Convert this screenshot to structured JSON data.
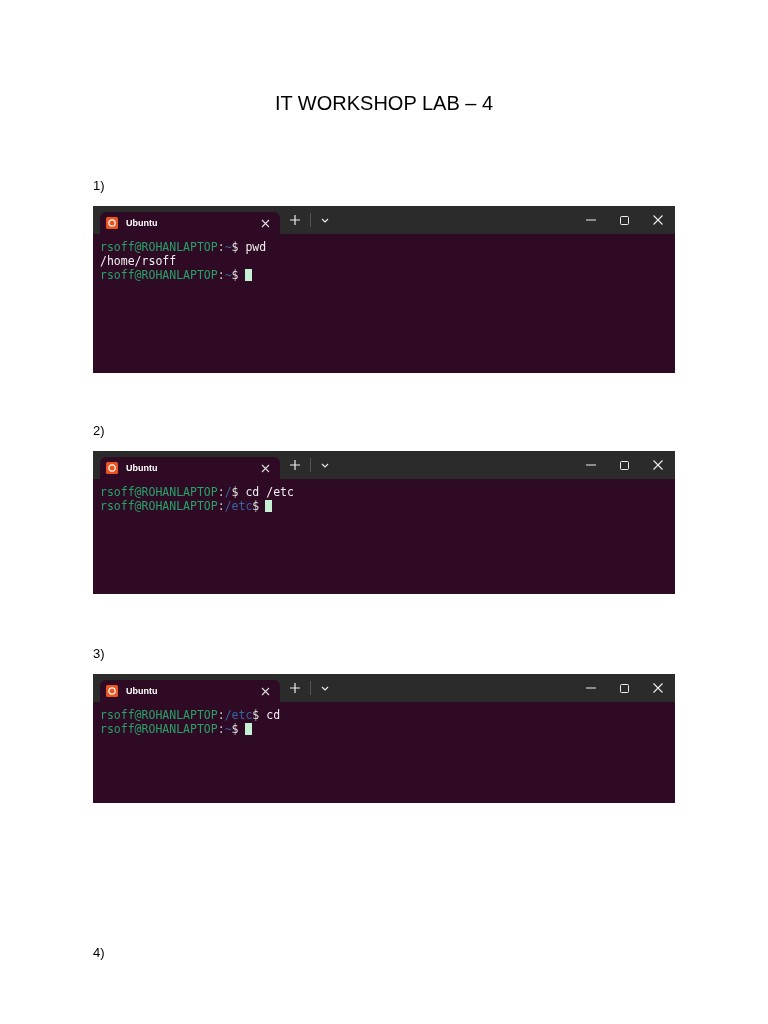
{
  "title": "IT WORKSHOP LAB – 4",
  "sections": [
    {
      "number": "1)",
      "terminal": {
        "tab_title": "Ubuntu",
        "lines": [
          {
            "kind": "prompt",
            "user": "rsoff@ROHANLAPTOP",
            "separator": ":",
            "path": "~",
            "symbol": "$",
            "command": "pwd",
            "cursor": false
          },
          {
            "kind": "output",
            "text": "/home/rsoff"
          },
          {
            "kind": "prompt",
            "user": "rsoff@ROHANLAPTOP",
            "separator": ":",
            "path": "~",
            "symbol": "$",
            "cursor": true
          }
        ]
      }
    },
    {
      "number": "2)",
      "terminal": {
        "tab_title": "Ubuntu",
        "lines": [
          {
            "kind": "prompt",
            "user": "rsoff@ROHANLAPTOP",
            "separator": ":",
            "path": "/",
            "symbol": "$",
            "command": "cd /etc",
            "cursor": false
          },
          {
            "kind": "prompt",
            "user": "rsoff@ROHANLAPTOP",
            "separator": ":",
            "path": "/etc",
            "symbol": "$",
            "cursor": true
          }
        ]
      }
    },
    {
      "number": "3)",
      "terminal": {
        "tab_title": "Ubuntu",
        "lines": [
          {
            "kind": "prompt",
            "user": "rsoff@ROHANLAPTOP",
            "separator": ":",
            "path": "/etc",
            "symbol": "$",
            "command": "cd",
            "cursor": false
          },
          {
            "kind": "prompt",
            "user": "rsoff@ROHANLAPTOP",
            "separator": ":",
            "path": "~",
            "symbol": "$",
            "cursor": true
          }
        ]
      }
    },
    {
      "number": "4)"
    }
  ]
}
